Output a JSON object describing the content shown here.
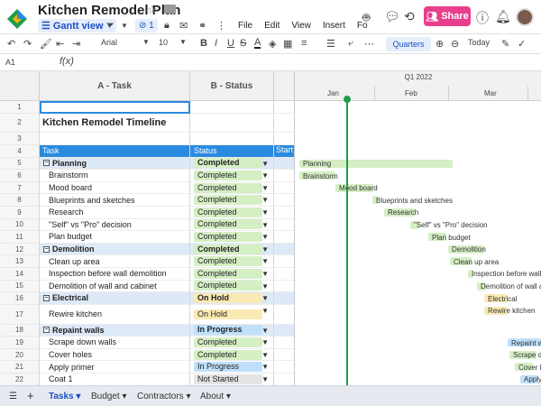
{
  "app": {
    "title": "Kitchen Remodel Plan",
    "view_label": "Gantt view",
    "filter_count": "1",
    "share_label": "Share",
    "menu": [
      "File",
      "Edit",
      "View",
      "Insert",
      "Fo"
    ]
  },
  "toolbar": {
    "font": "Arial",
    "size": "10",
    "timescale": "Quarters",
    "today_label": "Today"
  },
  "formula": {
    "cell_ref": "A1",
    "fx_label": "f(x)"
  },
  "grid": {
    "col_a": "A - Task",
    "col_b": "B - Status",
    "rows": [
      {
        "n": "1",
        "task": "",
        "status": "",
        "type": "blank"
      },
      {
        "n": "2",
        "task": "Kitchen Remodel Timeline",
        "status": "",
        "type": "title"
      },
      {
        "n": "3",
        "task": "",
        "status": "",
        "type": "blank"
      },
      {
        "n": "4",
        "task": "Task",
        "status": "Status",
        "start": "Start",
        "type": "header"
      },
      {
        "n": "5",
        "task": "Planning",
        "status": "Completed",
        "type": "group"
      },
      {
        "n": "6",
        "task": "Brainstorm",
        "status": "Completed",
        "type": "task"
      },
      {
        "n": "7",
        "task": "Mood board",
        "status": "Completed",
        "type": "task"
      },
      {
        "n": "8",
        "task": "Blueprints and sketches",
        "status": "Completed",
        "type": "task"
      },
      {
        "n": "9",
        "task": "Research",
        "status": "Completed",
        "type": "task"
      },
      {
        "n": "10",
        "task": "\"Self\" vs \"Pro\" decision",
        "status": "Completed",
        "type": "task"
      },
      {
        "n": "11",
        "task": "Plan budget",
        "status": "Completed",
        "type": "task"
      },
      {
        "n": "12",
        "task": "Demolition",
        "status": "Completed",
        "type": "group"
      },
      {
        "n": "13",
        "task": "Clean up area",
        "status": "Completed",
        "type": "task"
      },
      {
        "n": "14",
        "task": "Inspection before wall demolition",
        "status": "Completed",
        "type": "task"
      },
      {
        "n": "15",
        "task": "Demolition of wall and cabinet",
        "status": "Completed",
        "type": "task"
      },
      {
        "n": "16",
        "task": "Electrical",
        "status": "On Hold",
        "type": "group"
      },
      {
        "n": "17",
        "task": "Rewire kitchen",
        "status": "On Hold",
        "type": "task"
      },
      {
        "n": "18",
        "task": "Repaint walls",
        "status": "In Progress",
        "type": "group"
      },
      {
        "n": "19",
        "task": "Scrape down walls",
        "status": "Completed",
        "type": "task"
      },
      {
        "n": "20",
        "task": "Cover holes",
        "status": "Completed",
        "type": "task"
      },
      {
        "n": "21",
        "task": "Apply primer",
        "status": "In Progress",
        "type": "task"
      },
      {
        "n": "22",
        "task": "Coat 1",
        "status": "Not Started",
        "type": "task"
      }
    ]
  },
  "status_colors": {
    "Completed": "#d5efc4",
    "On Hold": "#fbe9b3",
    "In Progress": "#bfe0fb",
    "Not Started": "#e4e4e4"
  },
  "gantt": {
    "quarter": "Q1 2022",
    "months": [
      "Jan",
      "Feb",
      "Mar"
    ],
    "bars": [
      {
        "label": "Planning",
        "color": "green"
      },
      {
        "label": "Brainstorm",
        "color": "green"
      },
      {
        "label": "Mood board",
        "color": "green"
      },
      {
        "label": "Blueprints and sketches",
        "color": "green"
      },
      {
        "label": "Research",
        "color": "green"
      },
      {
        "label": "\"Self\" vs \"Pro\" decision",
        "color": "green"
      },
      {
        "label": "Plan budget",
        "color": "green"
      },
      {
        "label": "Demolition",
        "color": "green"
      },
      {
        "label": "Clean up area",
        "color": "green"
      },
      {
        "label": "Inspection before wall demolition",
        "color": "green"
      },
      {
        "label": "Demolition of wall and cabinet",
        "color": "green"
      },
      {
        "label": "Electrical",
        "color": "yellow"
      },
      {
        "label": "Rewire kitchen",
        "color": "yellow"
      },
      {
        "label": "Repaint walls",
        "color": "blue"
      },
      {
        "label": "Scrape down walls",
        "color": "green"
      },
      {
        "label": "Cover holes",
        "color": "green"
      },
      {
        "label": "Apply primer",
        "color": "blue"
      }
    ]
  },
  "sheet_tabs": [
    {
      "label": "Tasks",
      "active": true
    },
    {
      "label": "Budget",
      "active": false
    },
    {
      "label": "Contractors",
      "active": false
    },
    {
      "label": "About",
      "active": false
    }
  ]
}
